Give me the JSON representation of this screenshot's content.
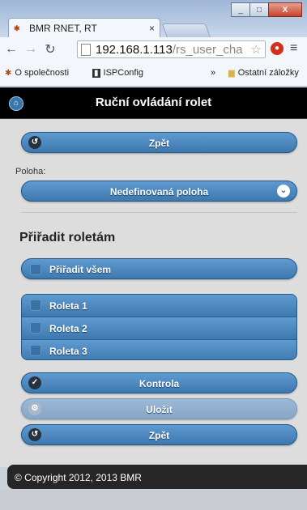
{
  "browser": {
    "tab_title": "BMR RNET, RT",
    "tab_close": "×",
    "window_buttons": {
      "minimize": "_",
      "maximize": "□",
      "close": "X"
    },
    "url_host": "192.168.1.113",
    "url_path": "/rs_user_cha",
    "bookmarks": [
      {
        "label": "O společnosti"
      },
      {
        "label": "ISPConfig"
      }
    ],
    "bookmarks_overflow": "»",
    "other_bookmarks": "Ostatní záložky"
  },
  "page": {
    "header_title": "Ruční ovládání rolet",
    "back_top": "Zpět",
    "position_label": "Poloha:",
    "position_value": "Nedefinovaná poloha",
    "assign_title": "Přiřadit roletám",
    "assign_all": "Přiřadit všem",
    "blinds": [
      {
        "label": "Roleta 1"
      },
      {
        "label": "Roleta 2"
      },
      {
        "label": "Roleta 3"
      }
    ],
    "check_button": "Kontrola",
    "save_button": "Uložit",
    "back_bottom": "Zpět",
    "footer": "© Copyright 2012, 2013 BMR"
  }
}
